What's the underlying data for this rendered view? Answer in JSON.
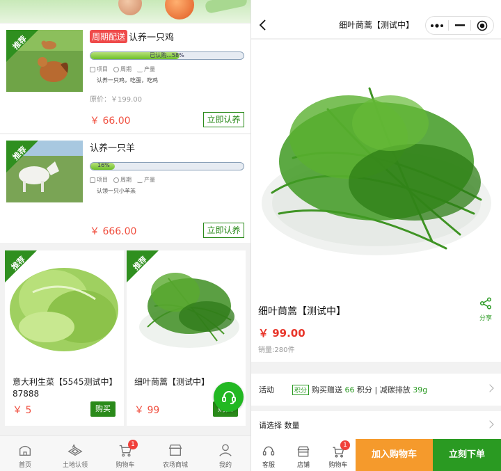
{
  "left": {
    "adopt_items": [
      {
        "badge": "推荐",
        "tag": "周期配送",
        "title": "认养一只鸡",
        "progress_text": "已认购...58%",
        "progress": 0.58,
        "meta": [
          "项目",
          "周期",
          "产量"
        ],
        "desc": "认养一只鸡，吃蛋，吃鸡",
        "original_price": "原价：￥199.00",
        "price": "￥ 66.00",
        "button": "立即认养"
      },
      {
        "badge": "推荐",
        "title": "认养一只羊",
        "progress_text": "16%",
        "progress": 0.16,
        "meta": [
          "项目",
          "周期",
          "产量"
        ],
        "desc": "认领一只小羊羔",
        "price": "￥ 666.00",
        "button": "立即认养"
      }
    ],
    "products": [
      {
        "badge": "推荐",
        "name": "意大利生菜【5545测试中】87888",
        "price": "￥ 5",
        "button": "购买"
      },
      {
        "badge": "推荐",
        "name": "细叶茼蒿【测试中】",
        "price": "￥ 99",
        "button": "购买"
      }
    ],
    "tabbar": [
      {
        "label": "首页",
        "icon": "home-icon"
      },
      {
        "label": "土地认领",
        "icon": "land-icon"
      },
      {
        "label": "购物车",
        "icon": "cart-icon",
        "badge": "1"
      },
      {
        "label": "农场商城",
        "icon": "store-icon"
      },
      {
        "label": "我的",
        "icon": "user-icon"
      }
    ]
  },
  "right": {
    "nav_title": "细叶茼蒿【测试中】",
    "product_name": "细叶茼蒿【测试中】",
    "share_label": "分享",
    "price": "￥ 99.00",
    "sold": "销量:280件",
    "activity": {
      "label": "活动",
      "tag": "积分",
      "text_prefix": "购买赠送",
      "points": "66",
      "points_unit": "积分",
      "sep": " | ",
      "carbon_label": "减碳排放",
      "carbon": "39g"
    },
    "select_label": "请选择 数量",
    "bottom": {
      "service": "客服",
      "shop": "店铺",
      "cart": "购物车",
      "cart_badge": "1",
      "add_cart": "加入购物车",
      "buy_now": "立刻下单"
    }
  },
  "colors": {
    "brand_green": "#2a9a22",
    "price_red": "#f04f3f",
    "cart_orange": "#f59a2c"
  }
}
